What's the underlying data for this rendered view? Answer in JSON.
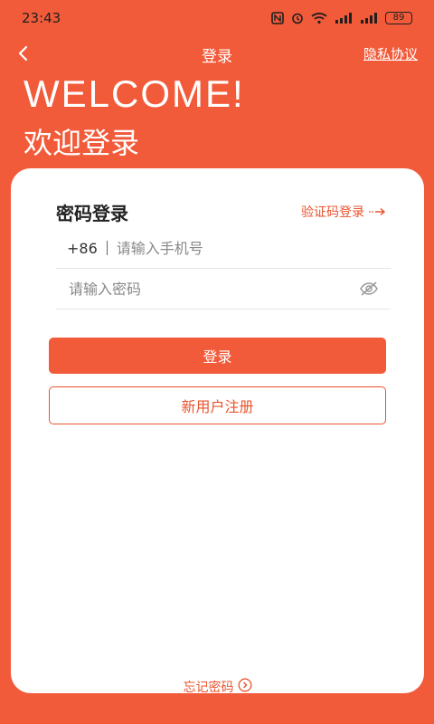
{
  "status_bar": {
    "time": "23:43",
    "battery": "89"
  },
  "header": {
    "title": "登录",
    "privacy_link": "隐私协议"
  },
  "welcome": {
    "en": "WELCOME!",
    "zh": "欢迎登录"
  },
  "login_form": {
    "mode_title": "密码登录",
    "switch_link": "验证码登录",
    "phone_prefix": "+86",
    "phone_placeholder": "请输入手机号",
    "phone_value": "",
    "password_placeholder": "请输入密码",
    "password_value": "",
    "login_button": "登录",
    "register_button": "新用户注册",
    "forgot_password": "忘记密码"
  },
  "colors": {
    "brand": "#f25b3a",
    "accent_text": "#e8542f"
  }
}
